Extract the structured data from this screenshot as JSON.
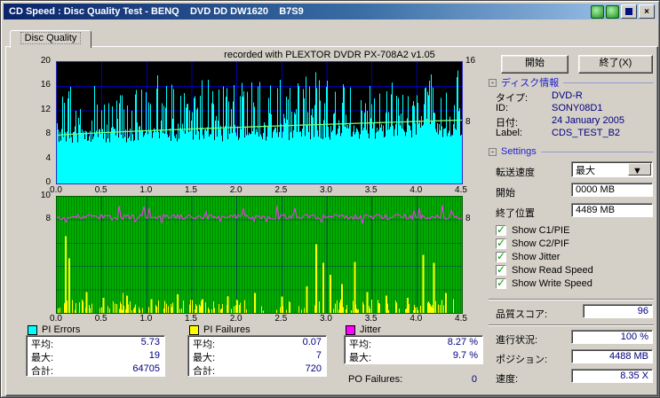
{
  "window": {
    "title": "CD Speed : Disc Quality Test - BENQ    DVD DD DW1620    B7S9"
  },
  "glyphs": {
    "minus": "-",
    "dropdown": "▼",
    "check": "✓",
    "close": "×"
  },
  "tab": {
    "label": "Disc Quality"
  },
  "note": "recorded with PLEXTOR DVDR   PX-708A2   v1.05",
  "buttons": {
    "start": "開始",
    "exit": "終了(X)"
  },
  "disc_info": {
    "header": "ディスク情報",
    "rows": [
      {
        "label": "タイプ:",
        "value": "DVD-R"
      },
      {
        "label": "ID:",
        "value": "SONY08D1"
      },
      {
        "label": "日付:",
        "value": "24 January 2005"
      },
      {
        "label": "Label:",
        "value": "CDS_TEST_B2"
      }
    ]
  },
  "settings": {
    "header": "Settings",
    "transfer_label": "転送速度",
    "transfer_value": "最大",
    "start_label": "開始",
    "start_value": "0000 MB",
    "end_label": "終了位置",
    "end_value": "4489 MB",
    "checkboxes": [
      {
        "label": "Show C1/PIE",
        "checked": true
      },
      {
        "label": "Show C2/PIF",
        "checked": true
      },
      {
        "label": "Show Jitter",
        "checked": true
      },
      {
        "label": "Show Read Speed",
        "checked": true
      },
      {
        "label": "Show Write Speed",
        "checked": true
      }
    ]
  },
  "score": {
    "label": "品質スコア:",
    "value": "96"
  },
  "status": {
    "rows": [
      {
        "label": "進行状況:",
        "value": "100 %"
      },
      {
        "label": "ポジション:",
        "value": "4488 MB"
      },
      {
        "label": "速度:",
        "value": "8.35 X"
      }
    ]
  },
  "legend": {
    "items": [
      {
        "label": "PI Errors",
        "color": "#00FFFF",
        "rows": [
          [
            "平均:",
            "5.73"
          ],
          [
            "最大:",
            "19"
          ],
          [
            "合計:",
            "64705"
          ]
        ]
      },
      {
        "label": "PI Failures",
        "color": "#FFFF00",
        "rows": [
          [
            "平均:",
            "0.07"
          ],
          [
            "最大:",
            "7"
          ],
          [
            "合計:",
            "720"
          ]
        ]
      },
      {
        "label": "Jitter",
        "color": "#FF00FF",
        "rows": [
          [
            "平均:",
            "8.27 %"
          ],
          [
            "最大:",
            "9.7 %"
          ]
        ]
      }
    ],
    "po_label": "PO Failures:",
    "po_value": "0"
  },
  "chart_data": {
    "top_chart": {
      "type": "area",
      "title": "C1/PIE errors with write speed curve",
      "x_range_gb": [
        0,
        4.5
      ],
      "y_left_range": [
        0,
        20
      ],
      "y_right_range": [
        0,
        16
      ],
      "x_ticks": [
        "0.0",
        "0.5",
        "1.0",
        "1.5",
        "2.0",
        "2.5",
        "3.0",
        "3.5",
        "4.0",
        "4.5"
      ],
      "y_left_ticks": [
        "20",
        "16",
        "12",
        "8",
        "4",
        "0"
      ],
      "y_right_ticks": [
        "16",
        "8"
      ],
      "grid_color": "#0000B4",
      "pie_color": "#00FFFF",
      "speed_color": "#7CFC7C",
      "pie_avg": 5.73,
      "pie_max": 19,
      "pie_total": 64705,
      "write_speed_start": 6.35,
      "write_speed_end": 8.35
    },
    "bottom_chart": {
      "type": "area",
      "title": "PI failures (yellow) and jitter (magenta)",
      "x_range_gb": [
        0,
        4.5
      ],
      "y_range": [
        0,
        10
      ],
      "x_ticks": [
        "0.0",
        "0.5",
        "1.0",
        "1.5",
        "2.0",
        "2.5",
        "3.0",
        "3.5",
        "4.0",
        "4.5"
      ],
      "y_left_ticks": [
        "10",
        "8"
      ],
      "y_right_ticks": [
        "8"
      ],
      "bg_color": "#00AC00",
      "pif_color": "#FFFF00",
      "jitter_color": "#FF30FF",
      "pif_avg": 0.07,
      "pif_max": 7,
      "pif_total": 720,
      "jitter_avg": 8.27,
      "jitter_max": 9.7,
      "po_failures": 0,
      "pif_spikes": [
        [
          0.1,
          6.6
        ],
        [
          0.14,
          4.7
        ],
        [
          0.33,
          1.8
        ],
        [
          0.52,
          1.3
        ],
        [
          0.78,
          1.5
        ],
        [
          1.05,
          1.2
        ],
        [
          1.34,
          1.6
        ],
        [
          1.62,
          1.2
        ],
        [
          1.9,
          1.4
        ],
        [
          2.2,
          1.7
        ],
        [
          2.5,
          1.4
        ],
        [
          2.78,
          2.3
        ],
        [
          2.88,
          5.9
        ],
        [
          2.96,
          4.3
        ],
        [
          3.04,
          3.3
        ],
        [
          3.17,
          2.5
        ],
        [
          3.31,
          4.4
        ],
        [
          3.45,
          1.8
        ],
        [
          3.66,
          1.5
        ],
        [
          3.9,
          1.3
        ],
        [
          4.07,
          5.0
        ],
        [
          4.19,
          4.3
        ],
        [
          4.32,
          1.7
        ]
      ]
    }
  }
}
